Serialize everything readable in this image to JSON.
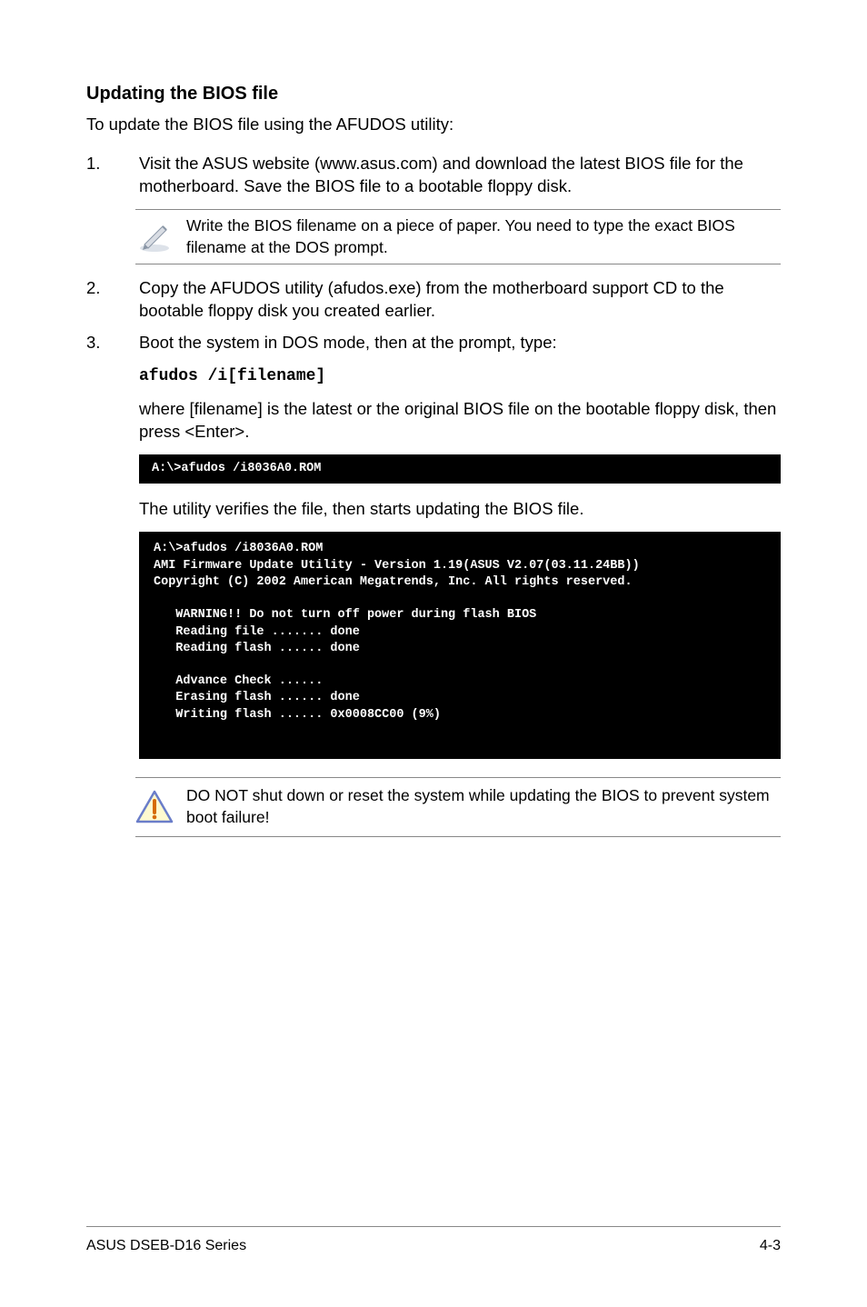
{
  "heading": "Updating the BIOS file",
  "intro": "To update the BIOS file using the AFUDOS utility:",
  "steps": {
    "s1_num": "1.",
    "s1_text": "Visit the ASUS website (www.asus.com) and download the latest BIOS file for the motherboard. Save the BIOS file to a bootable floppy disk.",
    "s2_num": "2.",
    "s2_text": "Copy the AFUDOS utility (afudos.exe) from the motherboard support CD to the bootable floppy disk you created earlier.",
    "s3_num": "3.",
    "s3_text": "Boot the system in DOS mode, then at the prompt, type:"
  },
  "note_text": "Write the BIOS filename on a piece of paper. You need to type the exact BIOS filename at the DOS prompt.",
  "code_cmd": "afudos /i[filename]",
  "where_text": "where [filename] is the latest or the original BIOS file on the bootable floppy disk, then press <Enter>.",
  "terminal_small": "A:\\>afudos /i8036A0.ROM",
  "verify_text": "The utility verifies the file, then starts updating the BIOS file.",
  "terminal_big": "A:\\>afudos /i8036A0.ROM\nAMI Firmware Update Utility - Version 1.19(ASUS V2.07(03.11.24BB))\nCopyright (C) 2002 American Megatrends, Inc. All rights reserved.\n\n   WARNING!! Do not turn off power during flash BIOS\n   Reading file ....... done\n   Reading flash ...... done\n\n   Advance Check ......\n   Erasing flash ...... done\n   Writing flash ...... 0x0008CC00 (9%)",
  "warning_text": "DO NOT shut down or reset the system while updating the BIOS to prevent system boot failure!",
  "footer_left": "ASUS DSEB-D16 Series",
  "footer_right": "4-3"
}
